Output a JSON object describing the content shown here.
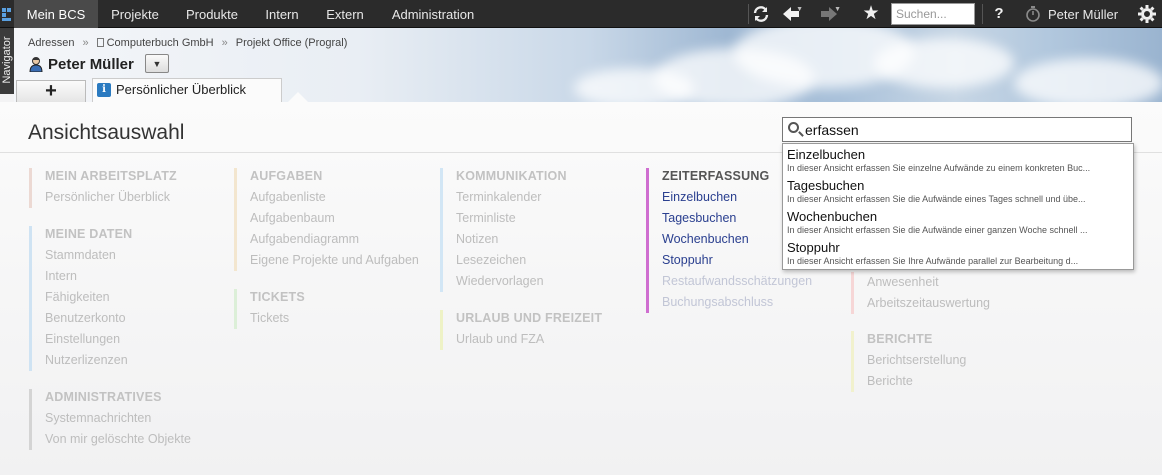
{
  "topnav": {
    "tabs": [
      "Mein BCS",
      "Projekte",
      "Produkte",
      "Intern",
      "Extern",
      "Administration"
    ],
    "search_placeholder": "Suchen...",
    "user": "Peter Müller",
    "help": "?",
    "icons": [
      "refresh-icon",
      "back-arrow-icon",
      "forward-arrow-icon",
      "star-icon",
      "help-icon",
      "timer-icon",
      "gear-icon"
    ]
  },
  "navigator_label": "Navigator",
  "breadcrumb": [
    "Adressen",
    "Computerbuch GmbH",
    "Projekt Office (Progral)"
  ],
  "person_name": "Peter Müller",
  "tabs": {
    "add": "+",
    "overview": "Persönlicher Überblick",
    "info_glyph": "i"
  },
  "page_title": "Ansichtsauswahl",
  "search": {
    "value": "erfassen"
  },
  "suggestions": [
    {
      "title": "Einzelbuchen",
      "desc": "In dieser Ansicht erfassen Sie einzelne Aufwände zu einem konkreten Buc..."
    },
    {
      "title": "Tagesbuchen",
      "desc": "In dieser Ansicht erfassen Sie die Aufwände eines Tages schnell und übe..."
    },
    {
      "title": "Wochenbuchen",
      "desc": "In dieser Ansicht erfassen Sie die Aufwände einer ganzen Woche schnell ..."
    },
    {
      "title": "Stoppuhr",
      "desc": "In dieser Ansicht erfassen Sie Ihre Aufwände parallel zur Bearbeitung d..."
    }
  ],
  "groups": {
    "arbeitsplatz": {
      "title": "MEIN ARBEITSPLATZ",
      "items": [
        "Persönlicher Überblick"
      ]
    },
    "daten": {
      "title": "MEINE DATEN",
      "items": [
        "Stammdaten",
        "Intern",
        "Fähigkeiten",
        "Benutzerkonto",
        "Einstellungen",
        "Nutzerlizenzen"
      ]
    },
    "admin": {
      "title": "ADMINISTRATIVES",
      "items": [
        "Systemnachrichten",
        "Von mir gelöschte Objekte"
      ]
    },
    "aufgaben": {
      "title": "AUFGABEN",
      "items": [
        "Aufgabenliste",
        "Aufgabenbaum",
        "Aufgabendiagramm",
        "Eigene Projekte und Aufgaben"
      ]
    },
    "tickets": {
      "title": "TICKETS",
      "items": [
        "Tickets"
      ]
    },
    "kommunikation": {
      "title": "KOMMUNIKATION",
      "items": [
        "Terminkalender",
        "Terminliste",
        "Notizen",
        "Lesezeichen",
        "Wiedervorlagen"
      ]
    },
    "urlaub": {
      "title": "URLAUB UND FREIZEIT",
      "items": [
        "Urlaub und FZA"
      ]
    },
    "zeit": {
      "title": "ZEITERFASSUNG",
      "items": [
        "Einzelbuchen",
        "Tagesbuchen",
        "Wochenbuchen",
        "Stoppuhr",
        "Restaufwandsschätzungen",
        "Buchungsabschluss"
      ]
    },
    "anwesenheit": {
      "items": [
        "Anwesenheit",
        "Arbeitszeitauswertung"
      ]
    },
    "berichte": {
      "title": "BERICHTE",
      "items": [
        "Berichtserstellung",
        "Berichte"
      ]
    }
  },
  "colors": {
    "arbeitsplatz": "#ecd9d3",
    "daten": "#cfe3f3",
    "admin": "#d4d4d4",
    "aufgaben": "#f3e6cf",
    "tickets": "#dcefd8",
    "kommunikation": "#d2e6f5",
    "urlaub": "#eef2c6",
    "zeit": "#cf6ed0",
    "anwesenheit": "#f6d6d6",
    "berichte": "#f1f1cd"
  }
}
